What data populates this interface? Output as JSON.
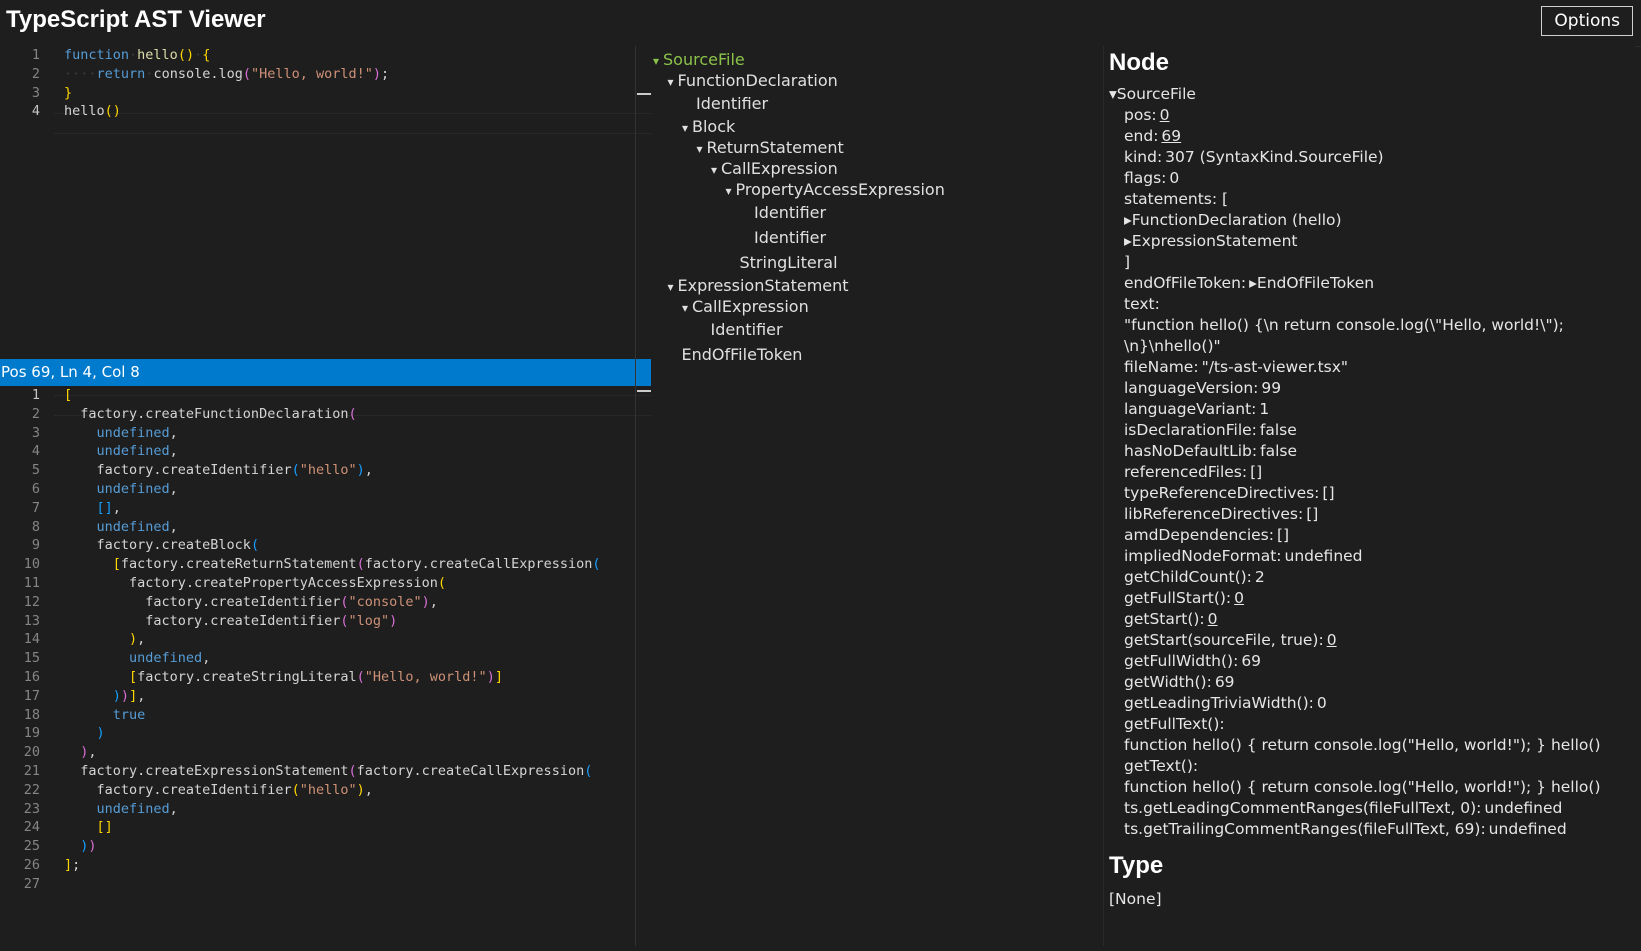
{
  "header": {
    "title": "TypeScript AST Viewer",
    "options_label": "Options"
  },
  "editor": {
    "lines": [
      [
        [
          "kw",
          "function"
        ],
        [
          "ws",
          "·"
        ],
        [
          "fn",
          "hello"
        ],
        [
          "br1",
          "()"
        ],
        [
          "ws",
          "·"
        ],
        [
          "br1",
          "{"
        ]
      ],
      [
        [
          "ws",
          "····"
        ],
        [
          "kw",
          "return"
        ],
        [
          "ws",
          "·"
        ],
        [
          "",
          "console.log"
        ],
        [
          "br2",
          "("
        ],
        [
          "str",
          "\"Hello, world!\""
        ],
        [
          "br2",
          ")"
        ],
        [
          "",
          ";"
        ]
      ],
      [
        [
          "br1",
          "}"
        ]
      ],
      [
        [
          "",
          "hello"
        ],
        [
          "br1",
          "()"
        ]
      ]
    ],
    "line_numbers": [
      "1",
      "2",
      "3",
      "4"
    ]
  },
  "status": {
    "text": "Pos 69, Ln 4, Col 8"
  },
  "factory": {
    "line_numbers": [
      "1",
      "2",
      "3",
      "4",
      "5",
      "6",
      "7",
      "8",
      "9",
      "10",
      "11",
      "12",
      "13",
      "14",
      "15",
      "16",
      "17",
      "18",
      "19",
      "20",
      "21",
      "22",
      "23",
      "24",
      "25",
      "26",
      "27"
    ],
    "lines": [
      [
        [
          "br1",
          "["
        ]
      ],
      [
        [
          "",
          "  factory.createFunctionDeclaration"
        ],
        [
          "br2",
          "("
        ]
      ],
      [
        [
          "",
          "    "
        ],
        [
          "kw",
          "undefined"
        ],
        [
          "",
          ","
        ]
      ],
      [
        [
          "",
          "    "
        ],
        [
          "kw",
          "undefined"
        ],
        [
          "",
          ","
        ]
      ],
      [
        [
          "",
          "    factory.createIdentifier"
        ],
        [
          "br3",
          "("
        ],
        [
          "str",
          "\"hello\""
        ],
        [
          "br3",
          ")"
        ],
        [
          "",
          ","
        ]
      ],
      [
        [
          "",
          "    "
        ],
        [
          "kw",
          "undefined"
        ],
        [
          "",
          ","
        ]
      ],
      [
        [
          "",
          "    "
        ],
        [
          "br3",
          "[]"
        ],
        [
          "",
          ","
        ]
      ],
      [
        [
          "",
          "    "
        ],
        [
          "kw",
          "undefined"
        ],
        [
          "",
          ","
        ]
      ],
      [
        [
          "",
          "    factory.createBlock"
        ],
        [
          "br3",
          "("
        ]
      ],
      [
        [
          "",
          "      "
        ],
        [
          "br1",
          "["
        ],
        [
          "",
          "factory.createReturnStatement"
        ],
        [
          "br2",
          "("
        ],
        [
          "",
          "factory.createCallExpression"
        ],
        [
          "br3",
          "("
        ]
      ],
      [
        [
          "",
          "        factory.createPropertyAccessExpression"
        ],
        [
          "br1",
          "("
        ]
      ],
      [
        [
          "",
          "          factory.createIdentifier"
        ],
        [
          "br2",
          "("
        ],
        [
          "str",
          "\"console\""
        ],
        [
          "br2",
          ")"
        ],
        [
          "",
          ","
        ]
      ],
      [
        [
          "",
          "          factory.createIdentifier"
        ],
        [
          "br2",
          "("
        ],
        [
          "str",
          "\"log\""
        ],
        [
          "br2",
          ")"
        ]
      ],
      [
        [
          "",
          "        "
        ],
        [
          "br1",
          ")"
        ],
        [
          "",
          ","
        ]
      ],
      [
        [
          "",
          "        "
        ],
        [
          "kw",
          "undefined"
        ],
        [
          "",
          ","
        ]
      ],
      [
        [
          "",
          "        "
        ],
        [
          "br1",
          "["
        ],
        [
          "",
          "factory.createStringLiteral"
        ],
        [
          "br2",
          "("
        ],
        [
          "str",
          "\"Hello, world!\""
        ],
        [
          "br2",
          ")"
        ],
        [
          "br1",
          "]"
        ]
      ],
      [
        [
          "",
          "      "
        ],
        [
          "br3",
          ")"
        ],
        [
          "br2",
          ")"
        ],
        [
          "br1",
          "]"
        ],
        [
          "",
          ","
        ]
      ],
      [
        [
          "",
          "      "
        ],
        [
          "kw",
          "true"
        ]
      ],
      [
        [
          "",
          "    "
        ],
        [
          "br3",
          ")"
        ]
      ],
      [
        [
          "",
          "  "
        ],
        [
          "br2",
          ")"
        ],
        [
          "",
          ","
        ]
      ],
      [
        [
          "",
          "  factory.createExpressionStatement"
        ],
        [
          "br2",
          "("
        ],
        [
          "",
          "factory.createCallExpression"
        ],
        [
          "br3",
          "("
        ]
      ],
      [
        [
          "",
          "    factory.createIdentifier"
        ],
        [
          "br1",
          "("
        ],
        [
          "str",
          "\"hello\""
        ],
        [
          "br1",
          ")"
        ],
        [
          "",
          ","
        ]
      ],
      [
        [
          "",
          "    "
        ],
        [
          "kw",
          "undefined"
        ],
        [
          "",
          ","
        ]
      ],
      [
        [
          "",
          "    "
        ],
        [
          "br1",
          "[]"
        ]
      ],
      [
        [
          "",
          "  "
        ],
        [
          "br3",
          ")"
        ],
        [
          "br2",
          ")"
        ]
      ],
      [
        [
          "br1",
          "]"
        ],
        [
          "",
          ";"
        ]
      ],
      []
    ]
  },
  "tree": {
    "nodes": [
      {
        "label": "SourceFile",
        "caret": "▾",
        "depth": 0,
        "selected": true
      },
      {
        "label": "FunctionDeclaration",
        "caret": "▾",
        "depth": 1
      },
      {
        "label": "Identifier",
        "caret": "",
        "depth": 2
      },
      {
        "label": "Block",
        "caret": "▾",
        "depth": 2
      },
      {
        "label": "ReturnStatement",
        "caret": "▾",
        "depth": 3
      },
      {
        "label": "CallExpression",
        "caret": "▾",
        "depth": 4
      },
      {
        "label": "PropertyAccessExpression",
        "caret": "▾",
        "depth": 5
      },
      {
        "label": "Identifier",
        "caret": "",
        "depth": 6
      },
      {
        "label": "Identifier",
        "caret": "",
        "depth": 6
      },
      {
        "label": "StringLiteral",
        "caret": "",
        "depth": 5
      },
      {
        "label": "ExpressionStatement",
        "caret": "▾",
        "depth": 1
      },
      {
        "label": "CallExpression",
        "caret": "▾",
        "depth": 2
      },
      {
        "label": "Identifier",
        "caret": "",
        "depth": 3
      },
      {
        "label": "EndOfFileToken",
        "caret": "",
        "depth": 1
      }
    ]
  },
  "details": {
    "node_title": "Node",
    "type_title": "Type",
    "type_value": "[None]",
    "root": "▾SourceFile",
    "props": [
      {
        "k": "pos:",
        "v": "0",
        "u": true
      },
      {
        "k": "end:",
        "v": "69",
        "u": true
      },
      {
        "k": "kind:",
        "v": "307 (SyntaxKind.SourceFile)"
      },
      {
        "k": "flags:",
        "v": "0"
      },
      {
        "k": "statements: [",
        "v": ""
      },
      {
        "k": " ▸FunctionDeclaration (hello)",
        "v": ""
      },
      {
        "k": " ▸ExpressionStatement",
        "v": ""
      },
      {
        "k": "]",
        "v": ""
      },
      {
        "k": "endOfFileToken:",
        "v": "▸EndOfFileToken"
      },
      {
        "k": "text:",
        "v": ""
      },
      {
        "k": "\"function hello() {\\n return console.log(\\\"Hello, world!\\\");",
        "v": ""
      },
      {
        "k": "\\n}\\nhello()\"",
        "v": ""
      },
      {
        "k": "fileName:",
        "v": "\"/ts-ast-viewer.tsx\""
      },
      {
        "k": "languageVersion:",
        "v": "99"
      },
      {
        "k": "languageVariant:",
        "v": "1"
      },
      {
        "k": "isDeclarationFile:",
        "v": "false"
      },
      {
        "k": "hasNoDefaultLib:",
        "v": "false"
      },
      {
        "k": "referencedFiles:",
        "v": "[]"
      },
      {
        "k": "typeReferenceDirectives:",
        "v": "[]"
      },
      {
        "k": "libReferenceDirectives:",
        "v": "[]"
      },
      {
        "k": "amdDependencies:",
        "v": "[]"
      },
      {
        "k": "impliedNodeFormat:",
        "v": "undefined"
      },
      {
        "k": "getChildCount():",
        "v": "2"
      },
      {
        "k": "getFullStart():",
        "v": "0",
        "u": true
      },
      {
        "k": "getStart():",
        "v": "0",
        "u": true
      },
      {
        "k": "getStart(sourceFile, true):",
        "v": "0",
        "u": true
      },
      {
        "k": "getFullWidth():",
        "v": "69"
      },
      {
        "k": "getWidth():",
        "v": "69"
      },
      {
        "k": "getLeadingTriviaWidth():",
        "v": "0"
      },
      {
        "k": "getFullText():",
        "v": ""
      },
      {
        "k": "function hello() { return console.log(\"Hello, world!\"); } hello()",
        "v": ""
      },
      {
        "k": "getText():",
        "v": ""
      },
      {
        "k": "function hello() { return console.log(\"Hello, world!\"); } hello()",
        "v": ""
      },
      {
        "k": "ts.getLeadingCommentRanges(fileFullText, 0):",
        "v": "undefined"
      },
      {
        "k": "ts.getTrailingCommentRanges(fileFullText, 69):",
        "v": "undefined"
      }
    ]
  }
}
